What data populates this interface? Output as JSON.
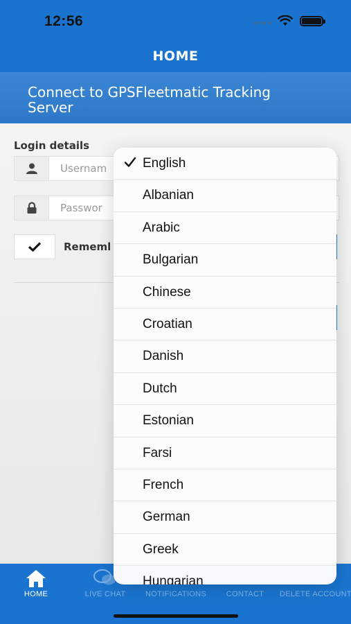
{
  "status_bar": {
    "time": "12:56"
  },
  "header": {
    "title": "HOME"
  },
  "banner": {
    "text": "Connect to GPSFleetmatic Tracking Server"
  },
  "form": {
    "section_label": "Login details",
    "username_placeholder": "Usernam",
    "password_placeholder": "Passwor",
    "remember_label": "Rememl",
    "remember_checked": true
  },
  "language_dropdown": {
    "selected": "English",
    "options": [
      "English",
      "Albanian",
      "Arabic",
      "Bulgarian",
      "Chinese",
      "Croatian",
      "Danish",
      "Dutch",
      "Estonian",
      "Farsi",
      "French",
      "German",
      "Greek",
      "Hungarian"
    ]
  },
  "tabs": [
    {
      "label": "HOME",
      "icon": "home-icon",
      "active": true
    },
    {
      "label": "LIVE CHAT",
      "icon": "chat-icon",
      "active": false
    },
    {
      "label": "NOTIFICATIONS",
      "icon": "bell-icon",
      "active": false
    },
    {
      "label": "CONTACT",
      "icon": "contact-icon",
      "active": false
    },
    {
      "label": "DELETE ACCOUNT",
      "icon": "delete-icon",
      "active": false
    }
  ],
  "colors": {
    "primary": "#1a74cf",
    "banner": "#2d78c8",
    "background": "#f0f0f0"
  }
}
